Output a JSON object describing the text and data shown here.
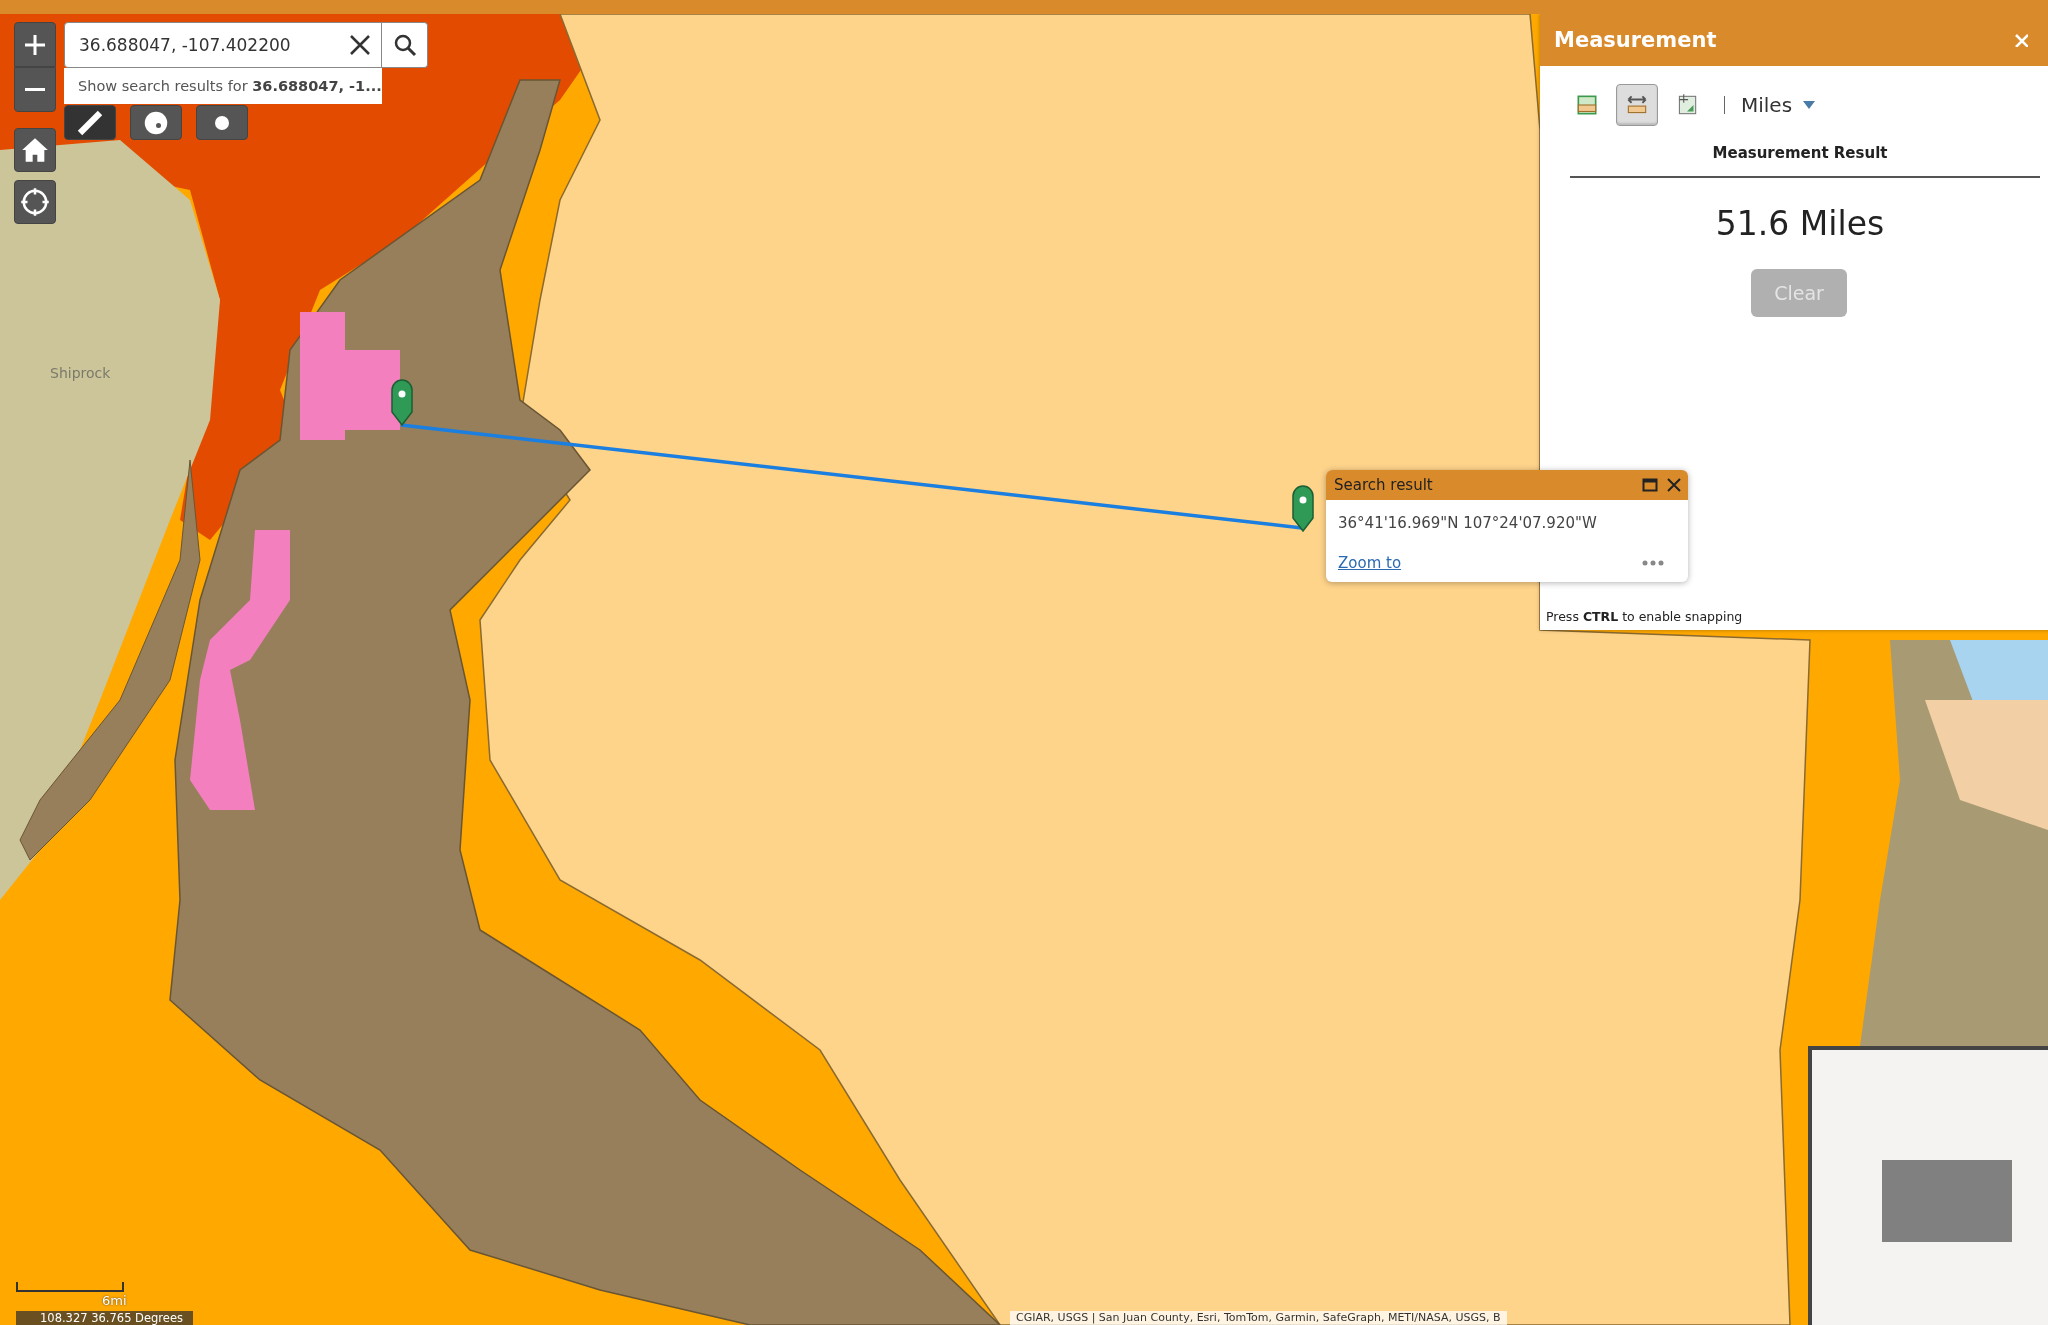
{
  "search": {
    "value": "36.688047, -107.402200",
    "suggestion": "Show search results for **36.688047, -1...**"
  },
  "map": {
    "labels": [
      {
        "text": "Shiprock"
      }
    ],
    "scale": "6mi",
    "coordinate_readout": "108.327 36.765 Degrees",
    "attribution": "CGIAR, USGS | San Juan County, Esri, TomTom, Garmin, SafeGraph, METI/NASA, USGS, B"
  },
  "measurement": {
    "title": "Measurement",
    "tools": [
      {
        "kind": "area",
        "selected": false
      },
      {
        "kind": "distance",
        "selected": true
      },
      {
        "kind": "location",
        "selected": false
      }
    ],
    "unit": "Miles",
    "result_heading": "Measurement Result",
    "result": "51.6 Miles",
    "clear_button": {
      "label": "Clear",
      "disabled": true
    },
    "hint": "Press **CTRL** to enable snapping"
  },
  "popup": {
    "title": "Search result",
    "coordinates": "36°41'16.969\"N 107°24'07.920\"W",
    "link": "Zoom to"
  }
}
